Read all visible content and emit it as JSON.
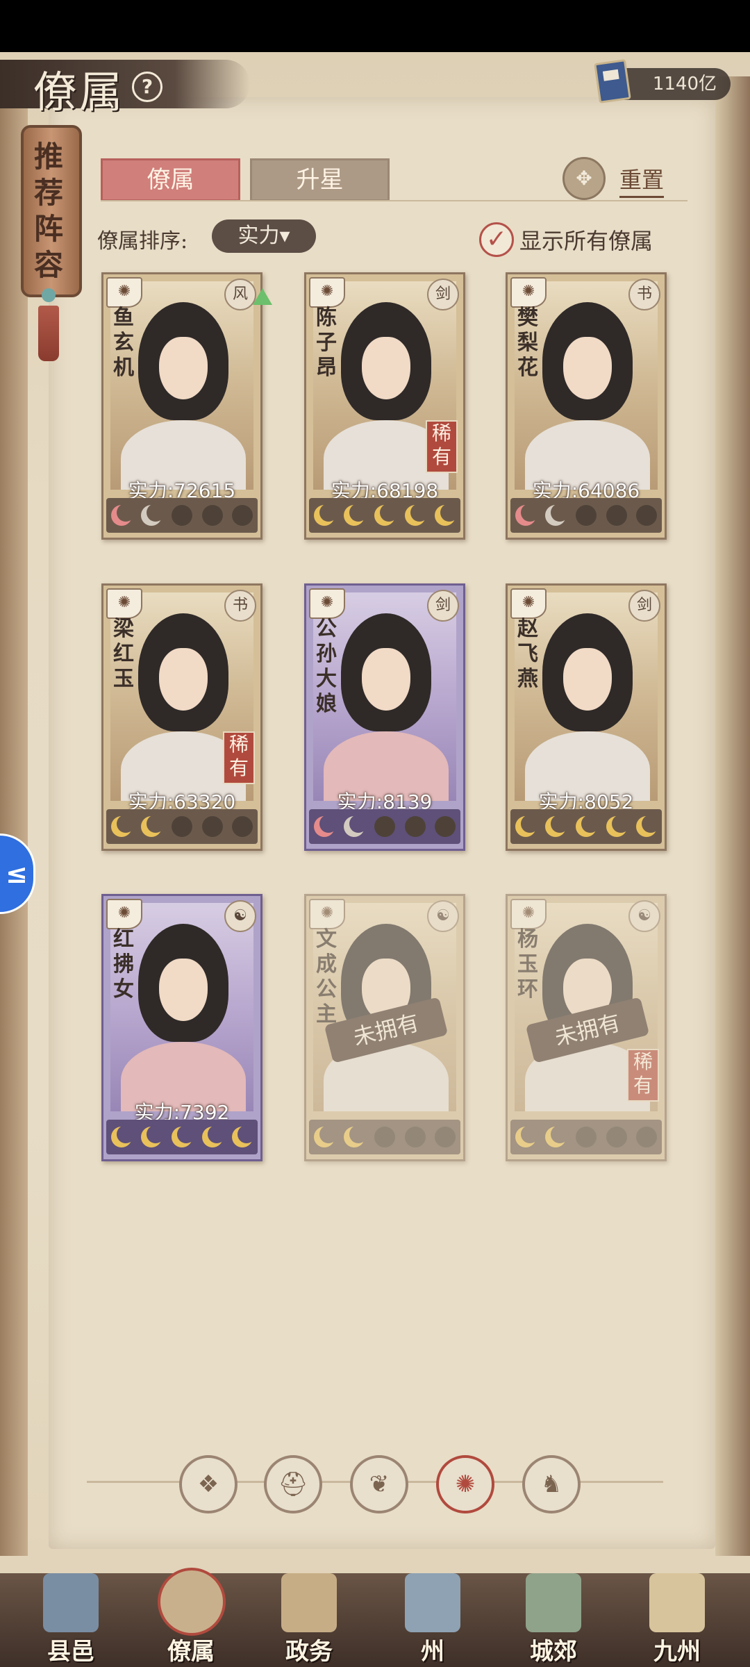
{
  "header": {
    "title": "僚属",
    "help_symbol": "?",
    "currency_amount": "1140亿"
  },
  "recommend_tag": "推荐阵容",
  "tabs": [
    {
      "label": "僚属",
      "active": true
    },
    {
      "label": "升星",
      "active": false
    }
  ],
  "reset_label": "重置",
  "sort": {
    "label": "僚属排序:",
    "selected": "实力"
  },
  "show_all": {
    "label": "显示所有僚属",
    "checked": true
  },
  "cards": [
    {
      "name": "鱼玄机",
      "power": "实力:72615",
      "owned": true,
      "rare": false,
      "frame": "gold",
      "class_icon": "风",
      "moons": [
        "pink",
        "grey",
        "empty",
        "empty",
        "empty"
      ],
      "upgrade_arrow": true
    },
    {
      "name": "陈子昂",
      "power": "实力:68198",
      "owned": true,
      "rare": true,
      "rare_label": "稀有",
      "frame": "gold",
      "class_icon": "剑",
      "moons": [
        "gold",
        "gold",
        "gold",
        "gold",
        "gold"
      ]
    },
    {
      "name": "樊梨花",
      "power": "实力:64086",
      "owned": true,
      "rare": false,
      "frame": "gold",
      "class_icon": "书",
      "moons": [
        "pink",
        "grey",
        "empty",
        "empty",
        "empty"
      ]
    },
    {
      "name": "梁红玉",
      "power": "实力:63320",
      "owned": true,
      "rare": true,
      "rare_label": "稀有",
      "frame": "gold",
      "class_icon": "书",
      "moons": [
        "gold",
        "gold",
        "empty",
        "empty",
        "empty"
      ]
    },
    {
      "name": "公孙大娘",
      "power": "实力:8139",
      "owned": true,
      "rare": false,
      "frame": "purple",
      "class_icon": "剑",
      "moons": [
        "pink",
        "grey",
        "empty",
        "empty",
        "empty"
      ]
    },
    {
      "name": "赵飞燕",
      "power": "实力:8052",
      "owned": true,
      "rare": false,
      "frame": "gold",
      "class_icon": "剑",
      "moons": [
        "gold",
        "gold",
        "gold",
        "gold",
        "gold"
      ]
    },
    {
      "name": "红拂女",
      "power": "实力:7392",
      "owned": true,
      "rare": false,
      "frame": "purple",
      "class_icon": "☯",
      "moons": [
        "gold",
        "gold",
        "gold",
        "gold",
        "gold"
      ]
    },
    {
      "name": "文成公主",
      "power": "",
      "owned": false,
      "unowned_label": "未拥有",
      "rare": false,
      "frame": "gold",
      "class_icon": "☯",
      "moons": [
        "gold",
        "gold",
        "empty",
        "empty",
        "empty"
      ]
    },
    {
      "name": "杨玉环",
      "power": "",
      "owned": false,
      "unowned_label": "未拥有",
      "rare": true,
      "rare_label": "稀有",
      "frame": "gold",
      "class_icon": "☯",
      "moons": [
        "gold",
        "gold",
        "empty",
        "empty",
        "empty"
      ]
    }
  ],
  "filters": [
    {
      "icon": "diamond-icon",
      "glyph": "❖",
      "active": false
    },
    {
      "icon": "helmet-icon",
      "glyph": "⛑",
      "active": false
    },
    {
      "icon": "cat-icon",
      "glyph": "❦",
      "active": false
    },
    {
      "icon": "fan-icon",
      "glyph": "✺",
      "active": true
    },
    {
      "icon": "lion-icon",
      "glyph": "♞",
      "active": false
    }
  ],
  "side_button": "≤",
  "nav": [
    {
      "label": "县邑",
      "active": false,
      "color": "#7a8ea3"
    },
    {
      "label": "僚属",
      "active": true,
      "color": "#c9b08c"
    },
    {
      "label": "政务",
      "active": false,
      "color": "#c7ad86"
    },
    {
      "label": "州",
      "active": false,
      "color": "#8ea2b3"
    },
    {
      "label": "城郊",
      "active": false,
      "color": "#8fa38a"
    },
    {
      "label": "九州",
      "active": false,
      "color": "#d8c49c"
    }
  ]
}
